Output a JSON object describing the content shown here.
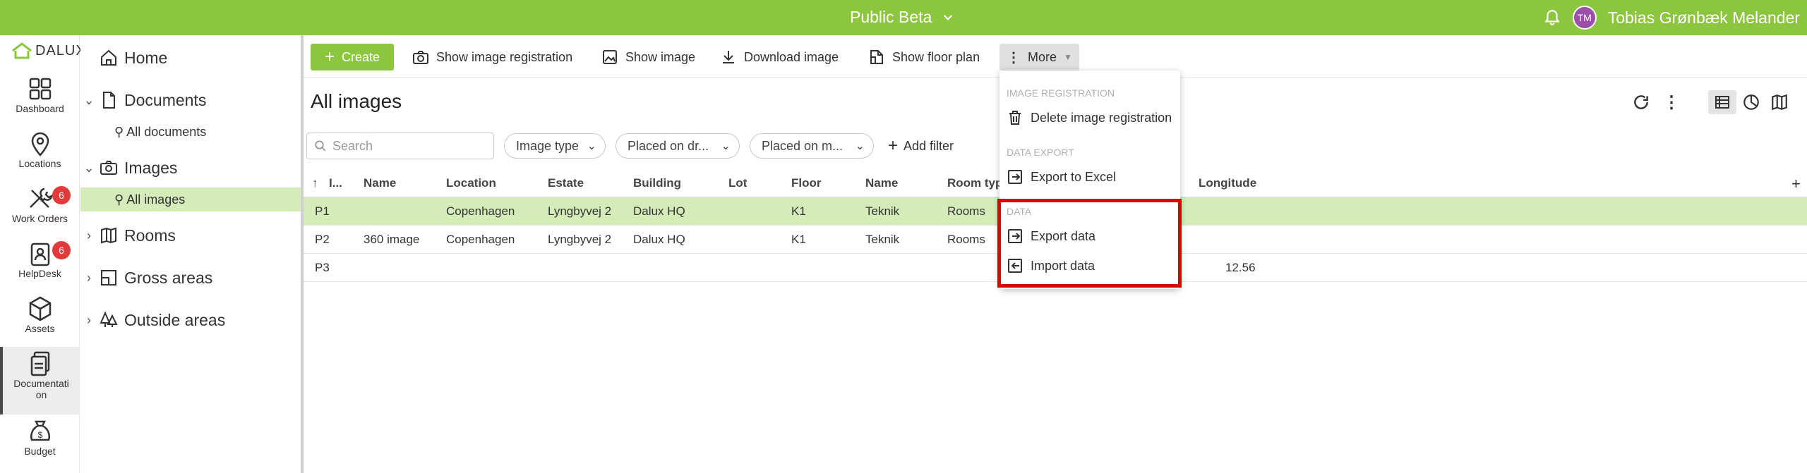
{
  "topbar": {
    "title": "Public Beta",
    "user_initials": "TM",
    "user_name": "Tobias Grønbæk Melander",
    "accent": "#8cc63f"
  },
  "rail": {
    "logo": "DALUX",
    "items": [
      {
        "label": "Dashboard",
        "icon": "dashboard-icon"
      },
      {
        "label": "Locations",
        "icon": "location-pin-icon"
      },
      {
        "label": "Work Orders",
        "icon": "tools-icon",
        "badge": "6"
      },
      {
        "label": "HelpDesk",
        "icon": "helpdesk-icon",
        "badge": "6"
      },
      {
        "label": "Assets",
        "icon": "cube-icon"
      },
      {
        "label": "Documentati on",
        "icon": "documents-icon"
      },
      {
        "label": "Budget",
        "icon": "money-bag-icon"
      }
    ]
  },
  "tree": {
    "home": "Home",
    "documents": "Documents",
    "all_documents": "All documents",
    "images": "Images",
    "all_images": "All images",
    "rooms": "Rooms",
    "gross_areas": "Gross areas",
    "outside_areas": "Outside areas"
  },
  "toolbar": {
    "create": "Create",
    "show_image_registration": "Show image registration",
    "show_image": "Show image",
    "download_image": "Download image",
    "show_floor_plan": "Show floor plan",
    "more": "More"
  },
  "page": {
    "title": "All images"
  },
  "filters": {
    "search_placeholder": "Search",
    "chips": [
      "Image type",
      "Placed on dr...",
      "Placed on m..."
    ],
    "add_filter": "Add filter"
  },
  "grid": {
    "columns": [
      "I...",
      "Name",
      "Location",
      "Estate",
      "Building",
      "Lot",
      "Floor",
      "Name",
      "Room typ",
      "Longitude"
    ],
    "rows": [
      {
        "id": "P1",
        "name": "",
        "location": "Copenhagen",
        "estate": "Lyngbyvej 2",
        "building": "Dalux HQ",
        "lot": "",
        "floor": "K1",
        "name2": "Teknik",
        "room_type": "Rooms",
        "longitude": ""
      },
      {
        "id": "P2",
        "name": "360 image",
        "location": "Copenhagen",
        "estate": "Lyngbyvej 2",
        "building": "Dalux HQ",
        "lot": "",
        "floor": "K1",
        "name2": "Teknik",
        "room_type": "Rooms",
        "longitude": ""
      },
      {
        "id": "P3",
        "name": "",
        "location": "",
        "estate": "",
        "building": "",
        "lot": "",
        "floor": "",
        "name2": "",
        "room_type": "",
        "longitude": "12.56"
      }
    ]
  },
  "more_menu": {
    "section_image_registration": "IMAGE REGISTRATION",
    "delete_image_registration": "Delete image registration",
    "section_data_export": "DATA EXPORT",
    "export_to_excel": "Export to Excel",
    "section_data": "DATA",
    "export_data": "Export data",
    "import_data": "Import data"
  }
}
